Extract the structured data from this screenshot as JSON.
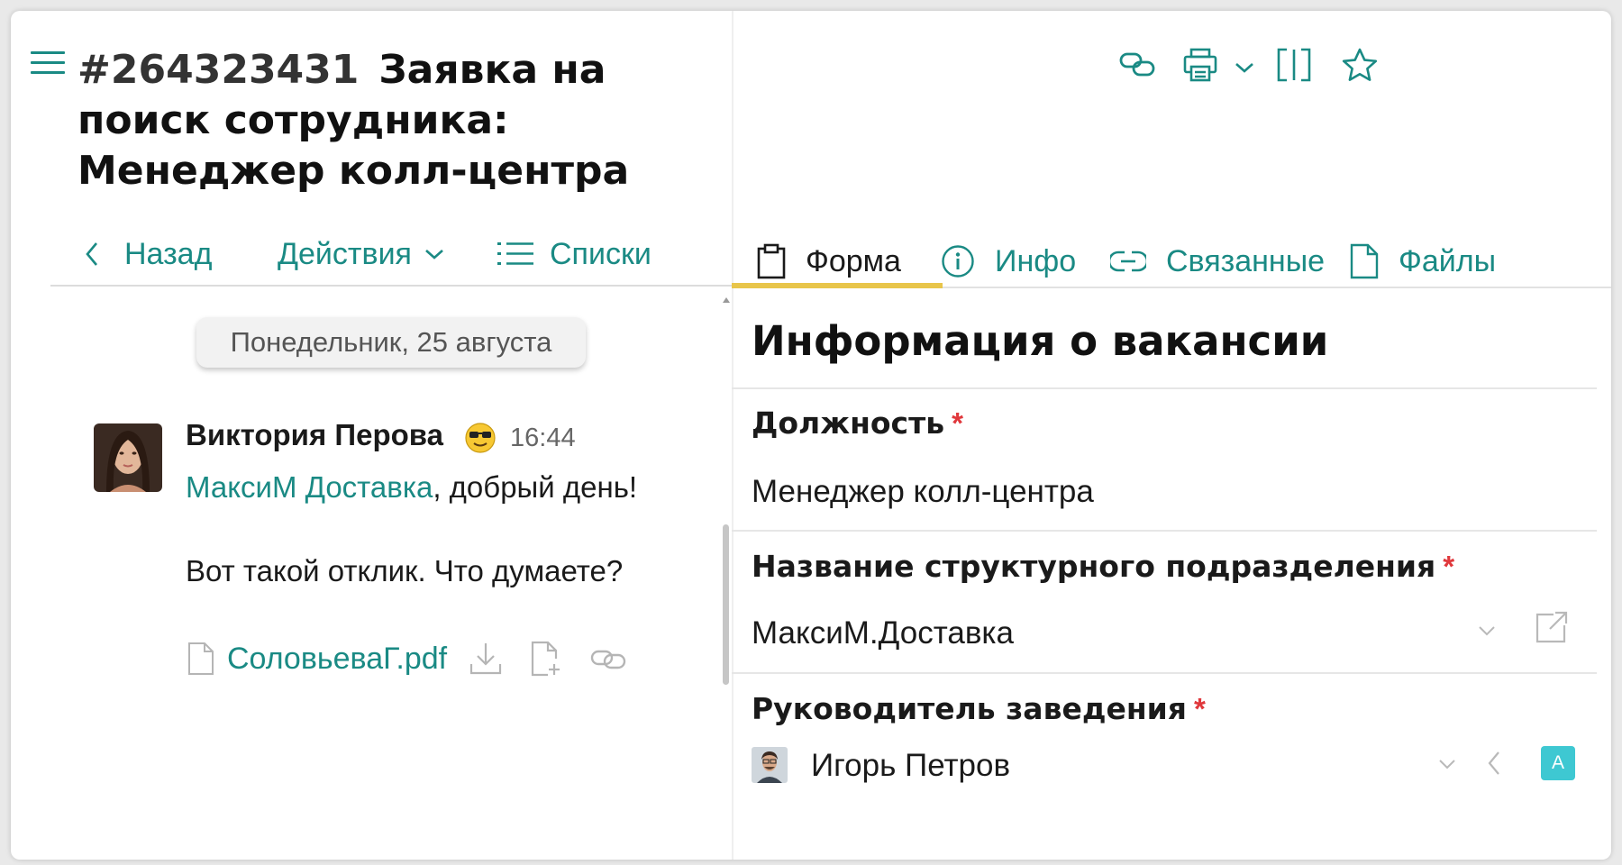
{
  "header": {
    "request_number": "#264323431",
    "request_title": "Заявка на поиск сотрудника: Менеджер колл-центра"
  },
  "nav": {
    "back_label": "Назад",
    "actions_label": "Действия",
    "lists_label": "Списки"
  },
  "chat": {
    "date_label": "Понедельник, 25 августа",
    "message": {
      "author": "Виктория Перова",
      "time": "16:44",
      "mention": "МаксиМ Доставка",
      "line1_rest": ", добрый день!",
      "line2": "Вот такой отклик. Что думаете?",
      "attachment_name": "СоловьеваГ.pdf"
    }
  },
  "tabs": [
    {
      "label": "Форма",
      "icon": "clipboard-icon",
      "active": true
    },
    {
      "label": "Инфо",
      "icon": "info-icon",
      "active": false
    },
    {
      "label": "Связанные",
      "icon": "link-icon",
      "active": false
    },
    {
      "label": "Файлы",
      "icon": "file-icon",
      "active": false
    }
  ],
  "form": {
    "section_title": "Информация о вакансии",
    "required_mark": "*",
    "fields": [
      {
        "label": "Должность",
        "value": "Менеджер колл-центра"
      },
      {
        "label": "Название структурного подразделения",
        "value": "МаксиМ.Доставка"
      },
      {
        "label": "Руководитель заведения",
        "value": "Игорь Петров",
        "badge": "A"
      }
    ]
  },
  "colors": {
    "accent": "#1a8a84",
    "active_tab_underline": "#e8c54a",
    "required": "#e0383c",
    "badge": "#3ec8d2"
  }
}
